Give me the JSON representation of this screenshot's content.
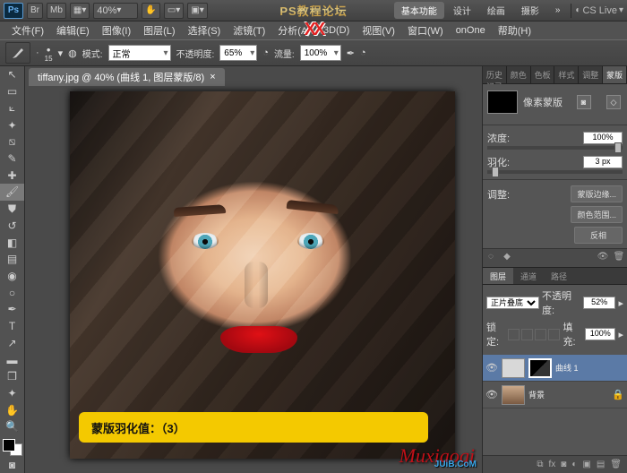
{
  "app": {
    "logo": "Ps",
    "zoom": "40%",
    "title_center": "PS教程论坛",
    "red_overlay": "XX"
  },
  "workspace_picker": {
    "items": [
      "基本功能",
      "设计",
      "绘画",
      "摄影"
    ],
    "active": 0,
    "cslive": "CS Live"
  },
  "menu": [
    "文件(F)",
    "编辑(E)",
    "图像(I)",
    "图层(L)",
    "选择(S)",
    "滤镜(T)",
    "分析(A)",
    "3D(D)",
    "视图(V)",
    "窗口(W)",
    "onOne",
    "帮助(H)"
  ],
  "options": {
    "size_label": "15",
    "mode_label": "模式:",
    "mode_val": "正常",
    "opacity_label": "不透明度:",
    "opacity_val": "65%",
    "flow_label": "流量:",
    "flow_val": "100%"
  },
  "tab": {
    "label": "tiffany.jpg @ 40% (曲线 1, 图层蒙版/8)",
    "close": "×"
  },
  "annotation": "蒙版羽化值：（3）",
  "mask_panel": {
    "tabs": [
      "历史记录",
      "颜色",
      "色板",
      "样式",
      "调整",
      "蒙版"
    ],
    "active": 5,
    "title": "像素蒙版",
    "density_label": "浓度:",
    "density_val": "100%",
    "feather_label": "羽化:",
    "feather_val": "3 px",
    "refine_label": "调整:",
    "btn_edge": "蒙版边缘...",
    "btn_color": "颜色范围...",
    "btn_invert": "反相"
  },
  "layers_panel": {
    "tabs": [
      "图层",
      "通道",
      "路径"
    ],
    "active": 0,
    "blend": "正片叠底",
    "opacity_label": "不透明度:",
    "opacity": "52%",
    "lock_label": "锁定:",
    "fill_label": "填充:",
    "fill": "100%",
    "layers": [
      {
        "name": "曲线 1",
        "type": "adjustment",
        "selected": true
      },
      {
        "name": "背景",
        "type": "image",
        "selected": false
      }
    ]
  },
  "signature": "Muxiaoqi",
  "watermark": "JUiB.CoM"
}
